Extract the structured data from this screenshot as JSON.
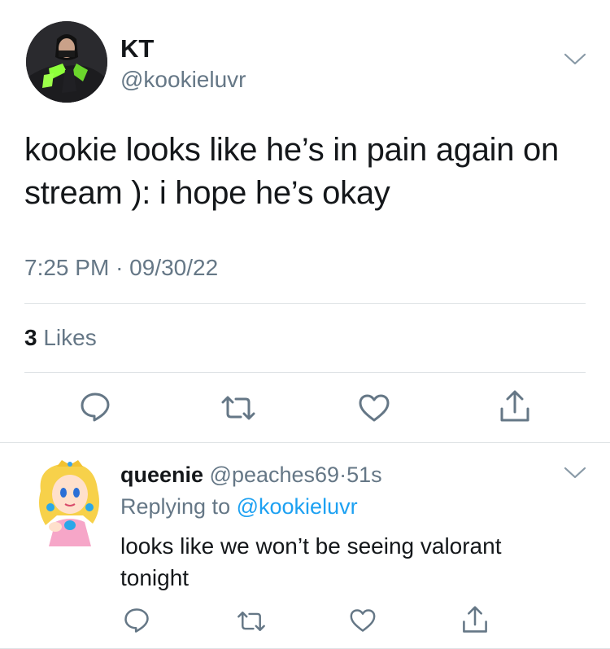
{
  "tweet": {
    "display_name": "KT",
    "handle": "@kookieluvr",
    "text": "kookie looks like he’s in pain again on stream ): i hope he’s okay",
    "time": "7:25 PM",
    "separator": "·",
    "date": "09/30/22",
    "likes_count": "3",
    "likes_label": "Likes",
    "icons": [
      "reply-icon",
      "retweet-icon",
      "like-icon",
      "share-icon",
      "chevron-down-icon"
    ]
  },
  "reply": {
    "display_name": "queenie",
    "handle": "@peaches69",
    "separator": "·",
    "time": "51s",
    "replying_prefix": "Replying to",
    "replying_to": "@kookieluvr",
    "text": "looks like we won’t be seeing valorant tonight",
    "icons": [
      "reply-icon",
      "retweet-icon",
      "like-icon",
      "share-icon",
      "chevron-down-icon"
    ]
  },
  "colors": {
    "text": "#14171a",
    "secondary": "#657786",
    "link": "#1da1f2",
    "divider": "#dfe3e6"
  }
}
